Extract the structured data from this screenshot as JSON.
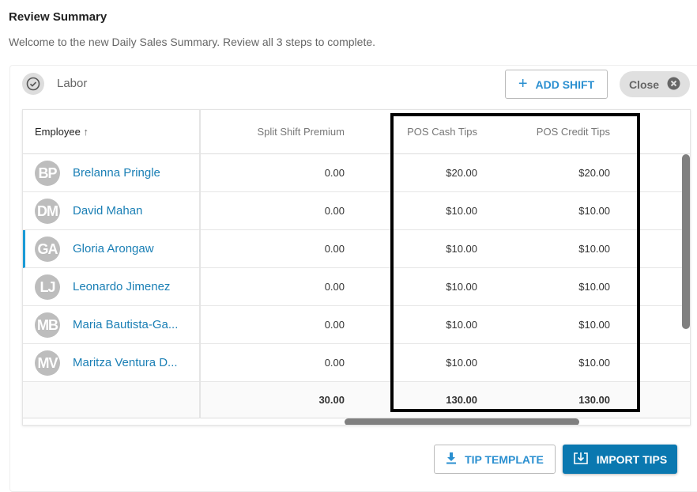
{
  "header": {
    "title": "Review Summary",
    "subtitle": "Welcome to the new Daily Sales Summary. Review all 3 steps to complete."
  },
  "section": {
    "label": "Labor",
    "add_shift": "ADD SHIFT",
    "close": "Close"
  },
  "table": {
    "columns": [
      "Employee",
      "Split Shift Premium",
      "POS Cash Tips",
      "POS Credit Tips"
    ],
    "sort": "ascending",
    "rows": [
      {
        "initials": "BP",
        "name": "Brelanna Pringle",
        "split": "0.00",
        "cash": "$20.00",
        "credit": "$20.00"
      },
      {
        "initials": "DM",
        "name": "David Mahan",
        "split": "0.00",
        "cash": "$10.00",
        "credit": "$10.00"
      },
      {
        "initials": "GA",
        "name": "Gloria Arongaw",
        "split": "0.00",
        "cash": "$10.00",
        "credit": "$10.00",
        "selected": true
      },
      {
        "initials": "LJ",
        "name": "Leonardo Jimenez",
        "split": "0.00",
        "cash": "$10.00",
        "credit": "$10.00"
      },
      {
        "initials": "MB",
        "name": "Maria Bautista-Ga...",
        "split": "0.00",
        "cash": "$10.00",
        "credit": "$10.00"
      },
      {
        "initials": "MV",
        "name": "Maritza Ventura D...",
        "split": "0.00",
        "cash": "$10.00",
        "credit": "$10.00"
      }
    ],
    "totals": {
      "split": "30.00",
      "cash": "130.00",
      "credit": "130.00"
    }
  },
  "actions": {
    "tip_template": "TIP TEMPLATE",
    "import_tips": "IMPORT TIPS"
  },
  "colors": {
    "accent": "#0a78b0",
    "link": "#1a7fb5",
    "selected": "#1a9ad6"
  }
}
